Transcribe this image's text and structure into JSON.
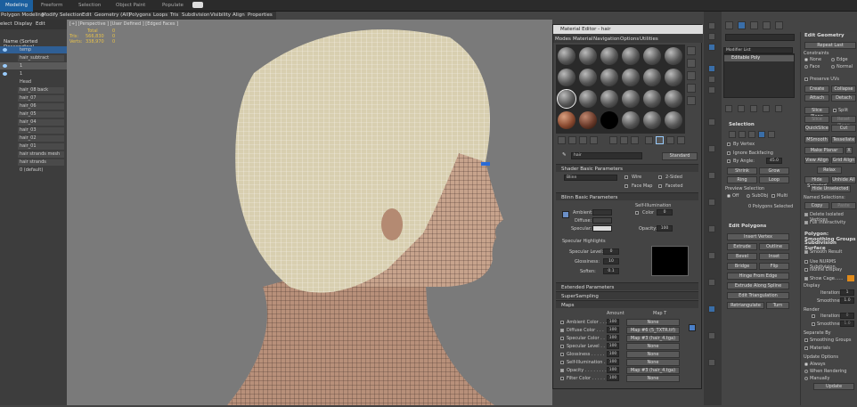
{
  "ribbon": {
    "tabs": [
      "Modeling",
      "Freeform",
      "Selection",
      "Object Paint",
      "Populate"
    ],
    "active": "Modeling"
  },
  "menubar": {
    "items": [
      "Polygon Modeling",
      "Modify Selection",
      "Edit",
      "Geometry (All)",
      "Polygons",
      "Loops",
      "Tris",
      "Subdivision",
      "Visibility",
      "Align",
      "Properties"
    ]
  },
  "leftmenu": {
    "items": [
      "elect",
      "Display",
      "Edit"
    ]
  },
  "explorer": {
    "header": "Name (Sorted Descending)",
    "rows": [
      "temp",
      "hair_subtract",
      "1",
      "1",
      "Head",
      "hair_08 back",
      "hair_07",
      "hair_06",
      "hair_05",
      "hair_04",
      "hair_03",
      "hair_02",
      "hair_01",
      "hair strands mesh",
      "hair strands",
      "0 (default)"
    ]
  },
  "viewport": {
    "label": "[+] [Perspective ] [User Defined ] [Edged Faces ]",
    "stats": {
      "total_label": "Total",
      "total_val": "0",
      "tris_label": "Tris:",
      "tris_val": "566,830",
      "verts_label": "Verts:",
      "verts_val": "338,970",
      "tris_right": "0",
      "verts_right": "0"
    }
  },
  "material_editor": {
    "title": "Material Editor - hair",
    "menu": [
      "Modes",
      "Material",
      "Navigation",
      "Options",
      "Utilities"
    ],
    "mat_name": "hair",
    "mat_type": "Standard",
    "shader": {
      "header": "Shader Basic Parameters",
      "type": "Blinn",
      "wire": "Wire",
      "two_sided": "2-Sided",
      "face_map": "Face Map",
      "faceted": "Faceted"
    },
    "blinn": {
      "header": "Blinn Basic Parameters",
      "self_illum": "Self-Illumination",
      "color": "Color",
      "ambient": "Ambient:",
      "diffuse": "Diffuse:",
      "specular": "Specular:",
      "opacity": "Opacity:",
      "opacity_val": "100",
      "color_val": "0",
      "highlights": "Specular Highlights",
      "spec_level": "Specular Level:",
      "spec_val": "0",
      "gloss": "Glossiness:",
      "gloss_val": "10",
      "soften": "Soften:",
      "soften_val": "0.1"
    },
    "rollouts": [
      "Extended Parameters",
      "SuperSampling",
      "Maps"
    ],
    "maps": {
      "amount_hdr": "Amount",
      "map_hdr": "Map T",
      "rows": [
        {
          "name": "Ambient Color . . .",
          "amt": "100",
          "map": "None"
        },
        {
          "name": "Diffuse Color . . .",
          "amt": "100",
          "map": "Map #6 (5_TXTR.tif)"
        },
        {
          "name": "Specular Color . . .",
          "amt": "100",
          "map": "Map #3 (hair_4.tga)"
        },
        {
          "name": "Specular Level . .",
          "amt": "100",
          "map": "None"
        },
        {
          "name": "Glossiness . . . . .",
          "amt": "100",
          "map": "None"
        },
        {
          "name": "Self-Illumination . .",
          "amt": "100",
          "map": "None"
        },
        {
          "name": "Opacity . . . . . . . .",
          "amt": "100",
          "map": "Map #3 (hair_4.tga)"
        },
        {
          "name": "Filter Color . . . . .",
          "amt": "100",
          "map": "None"
        }
      ]
    }
  },
  "modifier": {
    "list_label": "Modifier List",
    "stack_item": "Editable Poly",
    "selection": {
      "header": "Selection",
      "by_vertex": "By Vertex",
      "ignore_bf": "Ignore Backfacing",
      "by_angle": "By Angle:",
      "angle_val": "45.0",
      "shrink": "Shrink",
      "grow": "Grow",
      "ring": "Ring",
      "loop": "Loop",
      "preview": "Preview Selection",
      "off": "Off",
      "subobj": "SubObj",
      "multi": "Multi",
      "status": "0 Polygons Selected"
    },
    "edit_poly": {
      "header": "Edit Polygons",
      "insert_vertex": "Insert Vertex",
      "extrude": "Extrude",
      "outline": "Outline",
      "bevel": "Bevel",
      "inset": "Inset",
      "bridge": "Bridge",
      "flip": "Flip",
      "hinge": "Hinge From Edge",
      "extrude_spline": "Extrude Along Spline",
      "edit_tri": "Edit Triangulation",
      "retriangulate": "Retriangulate",
      "turn": "Turn"
    }
  },
  "edit_geometry": {
    "header": "Edit Geometry",
    "repeat_last": "Repeat Last",
    "constraints": "Constraints",
    "none": "None",
    "edge": "Edge",
    "face": "Face",
    "normal": "Normal",
    "preserve_uvs": "Preserve UVs",
    "create": "Create",
    "collapse": "Collapse",
    "attach": "Attach",
    "detach": "Detach",
    "slice_plane": "Slice Plane",
    "split": "Split",
    "slice": "Slice",
    "reset_plane": "Reset Plane",
    "quickslice": "QuickSlice",
    "cut": "Cut",
    "msmooth": "MSmooth",
    "tessellate": "Tessellate",
    "make_planar": "Make Planar",
    "x": "X",
    "y": "Y",
    "z": "Z",
    "view_align": "View Align",
    "grid_align": "Grid Align",
    "relax": "Relax",
    "hide_sel": "Hide Selected",
    "unhide_all": "Unhide All",
    "hide_unsel": "Hide Unselected",
    "named_sel": "Named Selections:",
    "copy": "Copy",
    "paste": "Paste",
    "delete_iso": "Delete Isolated Vertices",
    "full_inter": "Full Interactivity",
    "smoothing": "Polygon: Smoothing Groups",
    "subdiv": "Subdivision Surface",
    "smooth_result": "Smooth Result",
    "use_nurms": "Use NURMS Subdivision",
    "isoline": "Isoline Display",
    "show_cage": "Show Cage......",
    "display": "Display",
    "iterations": "Iterations:",
    "iter_val": "1",
    "smoothness": "Smoothness:",
    "smooth_val": "1.0",
    "render": "Render",
    "r_iter_val": "0",
    "r_smooth_val": "1.0",
    "sep_by": "Separate By",
    "sep_smoothing": "Smoothing Groups",
    "sep_materials": "Materials",
    "update_opts": "Update Options",
    "always": "Always",
    "when_render": "When Rendering",
    "manually": "Manually",
    "update": "Update"
  },
  "colors": {
    "accent": "#1b5f9e",
    "panel": "#454545",
    "viewport": "#7a7a7a"
  }
}
